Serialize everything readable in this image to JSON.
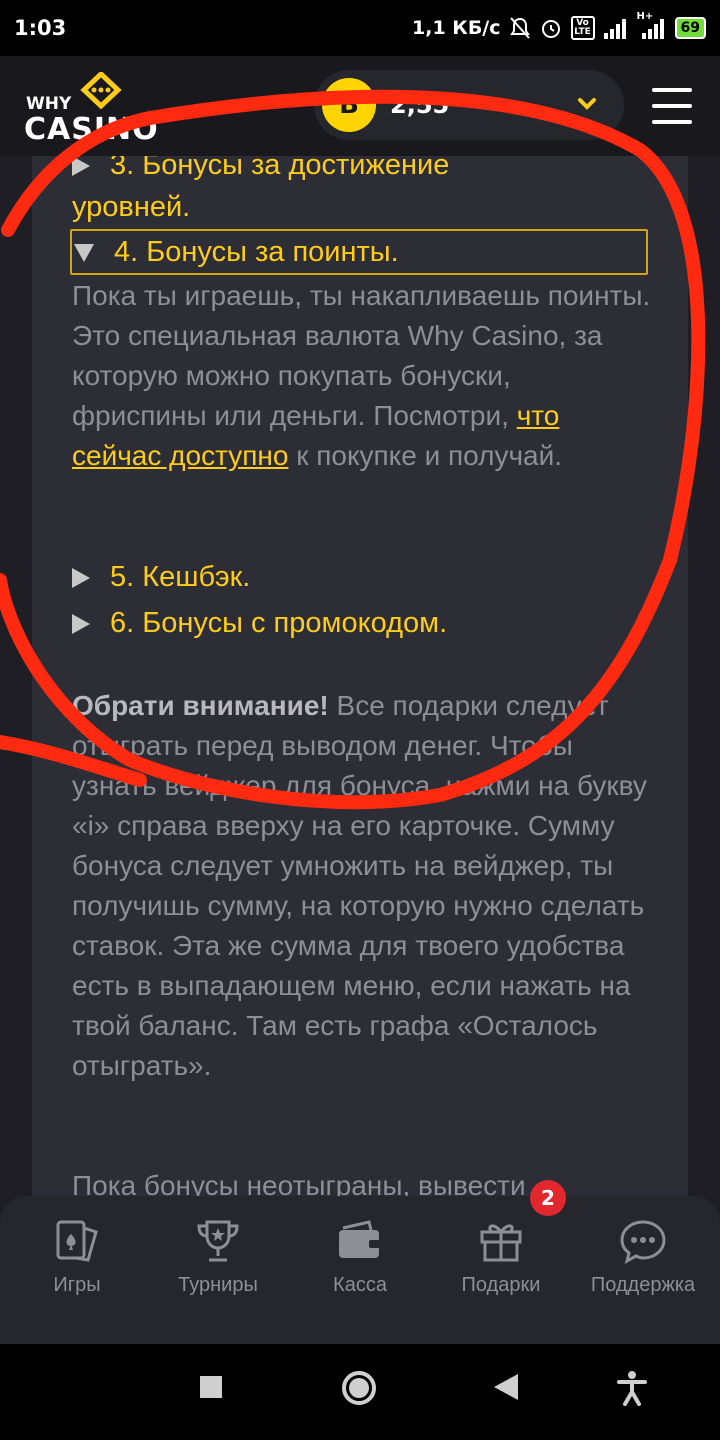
{
  "status_bar": {
    "time": "1:03",
    "net_speed": "1,1 КБ/с",
    "volte": "Vo LTE",
    "net_type": "H+",
    "battery": "69"
  },
  "header": {
    "logo_top": "WHY",
    "logo_bottom": "CASINO",
    "coin_letter": "B",
    "balance": "2,55"
  },
  "content": {
    "item3_line1": "3. Бонусы за достижение",
    "item3_line2": "уровней.",
    "item4_title": "4. Бонусы за поинты.",
    "item4_body_part1": "Пока ты играешь, ты накапливаешь поинты. Это специальная валюта Why Casino, за которую можно покупать бонуски, фриспины или деньги. Посмотри,",
    "item4_link": "что сейчас доступно",
    "item4_body_part2": "к покупке и получай.",
    "item5_title": "5. Кешбэк.",
    "item6_title": "6. Бонусы с промокодом.",
    "notice_bold": "Обрати внимание!",
    "notice_text": "Все подарки следует отыграть перед выводом денег. Чтобы узнать вейджер для бонуса, нажми на букву «i» справа вверху на его карточке. Сумму бонуса следует умножить на вейджер, ты получишь сумму, на которую нужно сделать ставок. Эта же сумма для твоего удобства есть в выпадающем меню, если нажать на твой баланс. Там есть графа «Осталось отыграть».",
    "last_line": "Пока бонусы неотыграны, вывести"
  },
  "bottom_nav": {
    "items": [
      {
        "label": "Игры",
        "icon": "cards-icon"
      },
      {
        "label": "Турниры",
        "icon": "trophy-icon"
      },
      {
        "label": "Касса",
        "icon": "wallet-icon"
      },
      {
        "label": "Подарки",
        "icon": "gift-icon"
      },
      {
        "label": "Поддержка",
        "icon": "chat-icon"
      }
    ],
    "gifts_badge": "2"
  },
  "colors": {
    "accent": "#ffcc1a",
    "background": "#1e1e24",
    "card": "#2d2d35",
    "annotation": "#ff2a10"
  }
}
